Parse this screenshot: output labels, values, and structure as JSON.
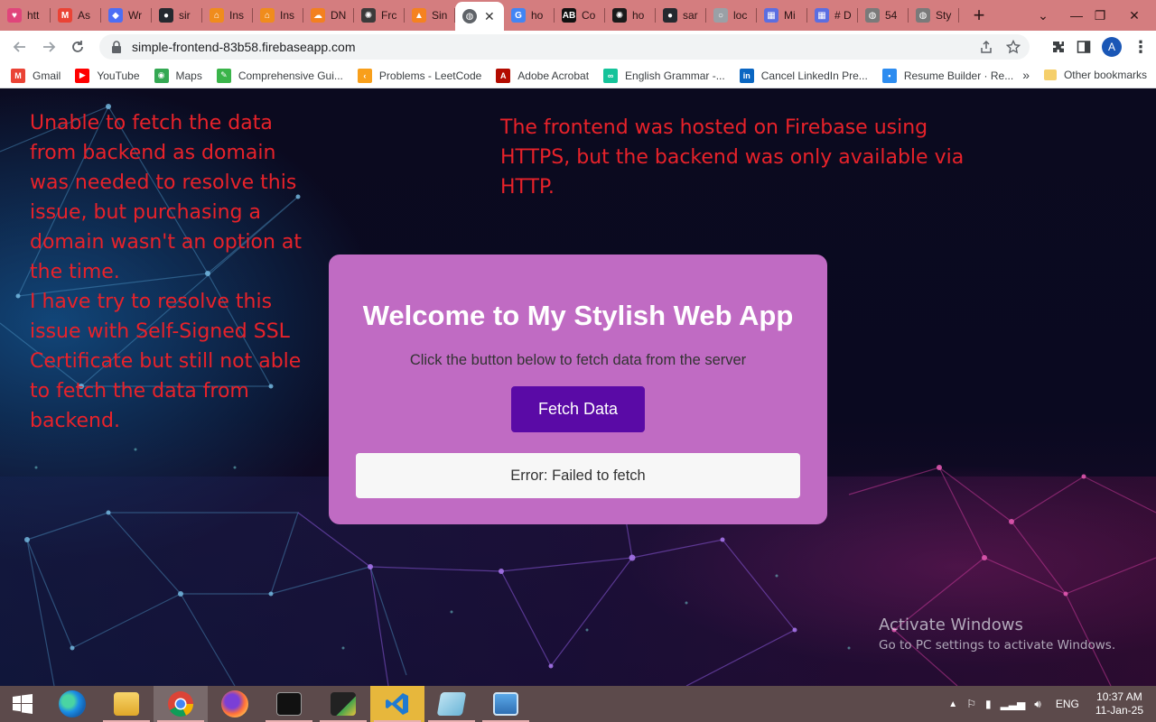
{
  "tabs": [
    {
      "title": "htt",
      "color": "#e0457b",
      "glyph": "♥"
    },
    {
      "title": "As",
      "color": "#ea4335",
      "glyph": "M"
    },
    {
      "title": "Wr",
      "color": "#4c6ef5",
      "glyph": "◆"
    },
    {
      "title": "sir",
      "color": "#24292f",
      "glyph": "●"
    },
    {
      "title": "Ins",
      "color": "#f08c1c",
      "glyph": "⌂"
    },
    {
      "title": "Ins",
      "color": "#f08c1c",
      "glyph": "⌂"
    },
    {
      "title": "DN",
      "color": "#f38020",
      "glyph": "☁"
    },
    {
      "title": "Frc",
      "color": "#3a3a3a",
      "glyph": "✺"
    },
    {
      "title": "Sin",
      "color": "#f58220",
      "glyph": "▲"
    }
  ],
  "active_tab": {
    "close": "✕"
  },
  "tabs_after": [
    {
      "title": "ho",
      "color": "#4285f4",
      "glyph": "G"
    },
    {
      "title": "Co",
      "color": "#111111",
      "glyph": "AB"
    },
    {
      "title": "ho",
      "color": "#1a1a1a",
      "glyph": "✺"
    },
    {
      "title": "sar",
      "color": "#24292f",
      "glyph": "●"
    },
    {
      "title": "loc",
      "color": "#9aa0a6",
      "glyph": "○"
    },
    {
      "title": "Mi",
      "color": "#5b6ee1",
      "glyph": "▦"
    },
    {
      "title": "# D",
      "color": "#5b6ee1",
      "glyph": "▦"
    },
    {
      "title": "54",
      "color": "#7a7a7a",
      "glyph": "◍"
    },
    {
      "title": "Sty",
      "color": "#7a7a7a",
      "glyph": "◍"
    }
  ],
  "new_tab": "+",
  "window_controls": [
    "⌄",
    "—",
    "❐",
    "✕"
  ],
  "address": {
    "url": "simple-frontend-83b58.firebaseapp.com"
  },
  "profile_initial": "A",
  "bookmarks": [
    {
      "label": "Gmail",
      "color": "#ea4335",
      "glyph": "M"
    },
    {
      "label": "YouTube",
      "color": "#ff0000",
      "glyph": "▶"
    },
    {
      "label": "Maps",
      "color": "#34a853",
      "glyph": "◉"
    },
    {
      "label": "Comprehensive Gui...",
      "color": "#3ab44a",
      "glyph": "✎"
    },
    {
      "label": "Problems - LeetCode",
      "color": "#f89f1b",
      "glyph": "‹"
    },
    {
      "label": "Adobe Acrobat",
      "color": "#b30b00",
      "glyph": "A"
    },
    {
      "label": "English Grammar -...",
      "color": "#15c39a",
      "glyph": "∞"
    },
    {
      "label": "Cancel LinkedIn Pre...",
      "color": "#0a66c2",
      "glyph": "in"
    },
    {
      "label": "Resume Builder · Re...",
      "color": "#2d8cf0",
      "glyph": "▪"
    }
  ],
  "bookmarks_more": "»",
  "other_bookmarks": "Other bookmarks",
  "page": {
    "note_left": "Unable to fetch the data from backend as domain was needed to resolve this issue, but purchasing a domain wasn't an option at the time.\nI have try to resolve this issue with Self-Signed SSL Certificate but still not able to fetch the data from backend.",
    "note_right": "The frontend was hosted on Firebase using HTTPS, but the backend was only available via HTTP.",
    "card": {
      "title": "Welcome to My Stylish Web App",
      "subtitle": "Click the button below to fetch data from the server",
      "button": "Fetch Data",
      "result": "Error: Failed to fetch"
    },
    "activate_title": "Activate Windows",
    "activate_sub": "Go to PC settings to activate Windows."
  },
  "taskbar": {
    "apps": [
      "start",
      "edge",
      "file-explorer",
      "chrome",
      "firefox",
      "command-prompt",
      "terminal",
      "vscode",
      "notepad",
      "photos"
    ],
    "language": "ENG",
    "time": "10:37 AM",
    "date": "11-Jan-25"
  }
}
